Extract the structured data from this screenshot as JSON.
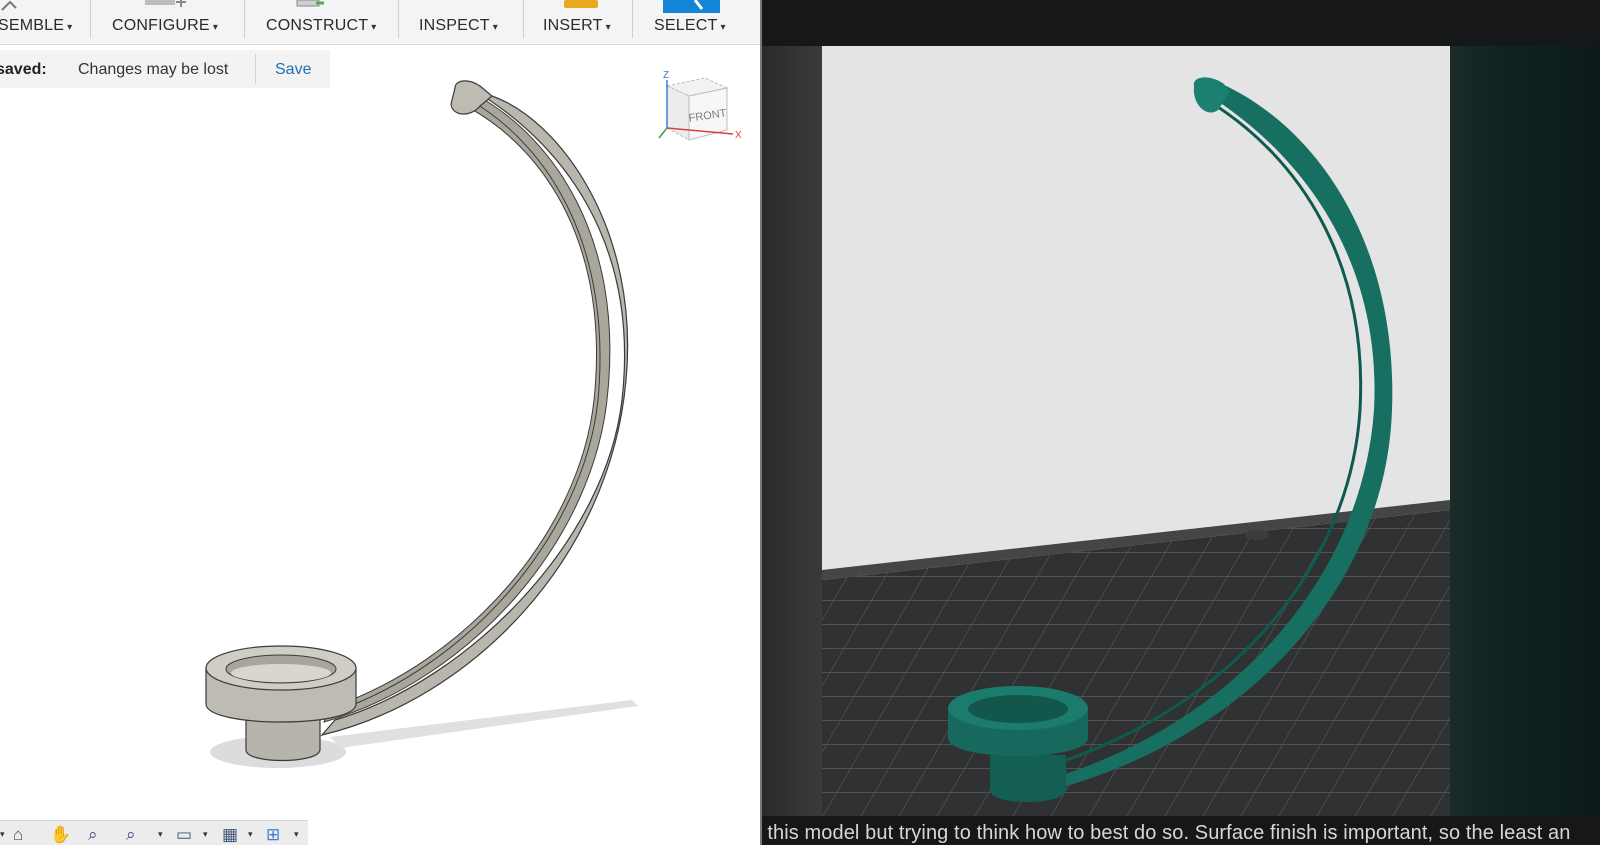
{
  "toolbar": {
    "items": [
      {
        "label": "SEMBLE"
      },
      {
        "label": "CONFIGURE"
      },
      {
        "label": "CONSTRUCT"
      },
      {
        "label": "INSPECT"
      },
      {
        "label": "INSERT"
      },
      {
        "label": "SELECT"
      }
    ],
    "caret": "▾"
  },
  "save_bar": {
    "status_label": "saved:",
    "message": "Changes may be lost",
    "save_button": "Save"
  },
  "viewcube": {
    "face_label": "FRONT",
    "axis_z": "Z",
    "axis_x": "X"
  },
  "colors": {
    "cad_model": "#b5b2a8",
    "slicer_model": "#176f62",
    "slicer_background": "#e4e4e4",
    "build_plate": "#2f3031",
    "accent_select": "#1485d6",
    "save_link": "#1d6fb5"
  },
  "nav_icons": [
    "orbit-icon",
    "pan-icon",
    "zoom-window-icon",
    "zoom-icon",
    "display-settings-icon",
    "grid-settings-icon",
    "viewports-icon"
  ],
  "caption": {
    "text": "t this model but trying to think how to best do so. Surface finish is important, so the least an"
  }
}
